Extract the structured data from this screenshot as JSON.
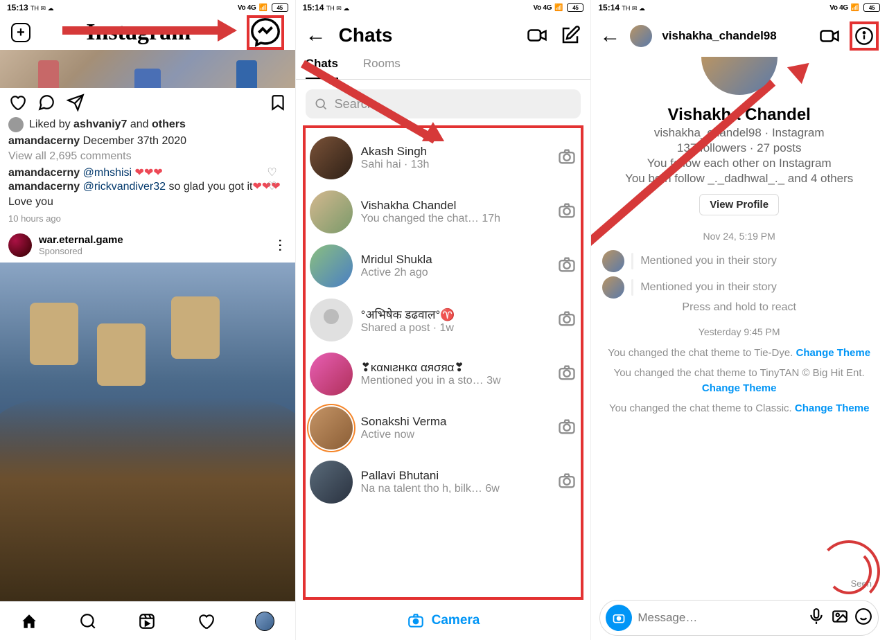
{
  "status": {
    "time1": "15:13",
    "time2": "15:14",
    "time3": "15:14",
    "indicators": "TH ✉ ☁",
    "signal": "Vo 4G",
    "battery": "45"
  },
  "p1": {
    "logo": "Instagram",
    "liked_by_prefix": "Liked by ",
    "liked_by_user": "ashvaniy7",
    "liked_by_suffix": " and ",
    "liked_by_others": "others",
    "caption_user": "amandacerny",
    "caption_text": " December 37th 2020",
    "viewall": "View all 2,695 comments",
    "c1_user": "amandacerny",
    "c1_tag": " @mhshisi ",
    "c1_hearts": "❤❤❤",
    "c2_user": "amandacerny",
    "c2_tag": " @rickvandiver32 ",
    "c2_text": "so glad you got it",
    "c2_hearts": "❤❤❤",
    "c2_tail": "Love you",
    "time": "10 hours ago",
    "sponsor_name": "war.eternal.game",
    "sponsor_tag": "Sponsored"
  },
  "p2": {
    "title": "Chats",
    "tabs": {
      "chats": "Chats",
      "rooms": "Rooms"
    },
    "search_ph": "Search",
    "camera": "Camera",
    "chats": [
      {
        "name": "Akash Singh",
        "sub": "Sahi hai · 13h"
      },
      {
        "name": "Vishakha Chandel",
        "sub": "You changed the chat…  17h"
      },
      {
        "name": "Mridul Shukla",
        "sub": "Active 2h ago"
      },
      {
        "name": "°अभिषेक डढवाल°♈",
        "sub": "Shared a post · 1w"
      },
      {
        "name": "❣καɴιƨнκα αяσяα❣",
        "sub": "Mentioned you in a sto…  3w"
      },
      {
        "name": "Sonakshi Verma",
        "sub": "Active now"
      },
      {
        "name": "Pallavi Bhutani",
        "sub": "Na na talent tho h, bilk…  6w"
      }
    ]
  },
  "p3": {
    "username": "vishakha_chandel98",
    "fullname": "Vishakha Chandel",
    "uline": "vishakha_chandel98 · Instagram",
    "stats": "137 followers · 27 posts",
    "follow1": "You follow each other on Instagram",
    "follow2": "You both follow _._dadhwal_._ and 4 others",
    "viewp": "View Profile",
    "d1": "Nov 24, 5:19 PM",
    "story": "Mentioned you in their story",
    "react": "Press and hold to react",
    "d2": "Yesterday 9:45 PM",
    "s1a": "You changed the chat theme to Tie-Dye. ",
    "s1b": "Change Theme",
    "s2a": "You changed the chat theme to TinyTAN © Big Hit Ent. ",
    "s2b": "Change Theme",
    "s3a": "You changed the chat theme to Classic. ",
    "s3b": "Change Theme",
    "seen": "Seen",
    "msg_ph": "Message…"
  }
}
